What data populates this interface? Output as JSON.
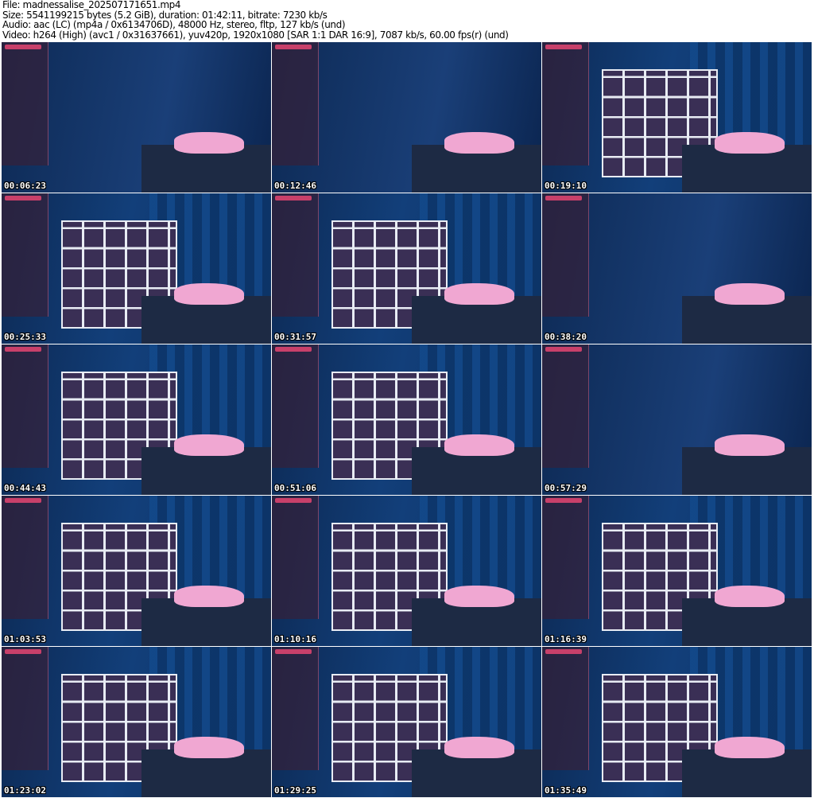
{
  "header": {
    "file": "File: madnessalise_202507171651.mp4",
    "size": "Size: 5541199215 bytes (5.2 GiB), duration: 01:42:11, bitrate: 7230 kb/s",
    "audio": "Audio: aac (LC) (mp4a / 0x6134706D), 48000 Hz, stereo, fltp, 127 kb/s (und)",
    "video": "Video: h264 (High) (avc1 / 0x31637661), yuv420p, 1920x1080 [SAR 1:1 DAR 16:9], 7087 kb/s, 60.00 fps(r) (und)"
  },
  "thumbnails": [
    {
      "time": "00:06:23"
    },
    {
      "time": "00:12:46"
    },
    {
      "time": "00:19:10"
    },
    {
      "time": "00:25:33"
    },
    {
      "time": "00:31:57"
    },
    {
      "time": "00:38:20"
    },
    {
      "time": "00:44:43"
    },
    {
      "time": "00:51:06"
    },
    {
      "time": "00:57:29"
    },
    {
      "time": "01:03:53"
    },
    {
      "time": "01:10:16"
    },
    {
      "time": "01:16:39"
    },
    {
      "time": "01:23:02"
    },
    {
      "time": "01:29:25"
    },
    {
      "time": "01:35:49"
    }
  ]
}
